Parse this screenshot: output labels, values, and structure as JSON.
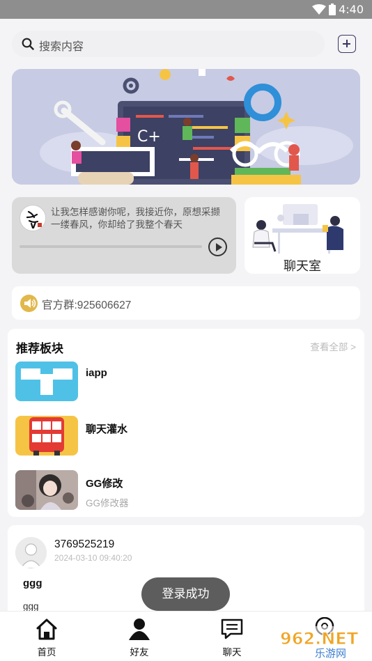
{
  "status_bar": {
    "time": "4:40"
  },
  "search": {
    "placeholder": "搜索内容"
  },
  "music_card": {
    "lyric": "让我怎样感谢你呢，我接近你，原想采撷一缕春风，你却给了我整个春天",
    "progress": 0.0
  },
  "chat_room": {
    "label": "聊天室"
  },
  "notice": {
    "text": "官方群:925606627"
  },
  "recommend": {
    "title": "推荐板块",
    "more": "查看全部 >",
    "boards": [
      {
        "name": "iapp",
        "desc": ""
      },
      {
        "name": "聊天灌水",
        "desc": ""
      },
      {
        "name": "GG修改",
        "desc": "GG修改器"
      }
    ]
  },
  "post": {
    "username": "3769525219",
    "date": "2024-03-10 09:40:20",
    "title": "ggg",
    "body": "ggg"
  },
  "toast": "登录成功",
  "tabs": [
    {
      "label": "首页",
      "icon": "home-icon"
    },
    {
      "label": "好友",
      "icon": "person-icon"
    },
    {
      "label": "聊天",
      "icon": "chat-icon"
    },
    {
      "label": "",
      "icon": "profile-icon"
    }
  ],
  "watermark": {
    "line1": "962.NET",
    "line2": "乐游网"
  }
}
